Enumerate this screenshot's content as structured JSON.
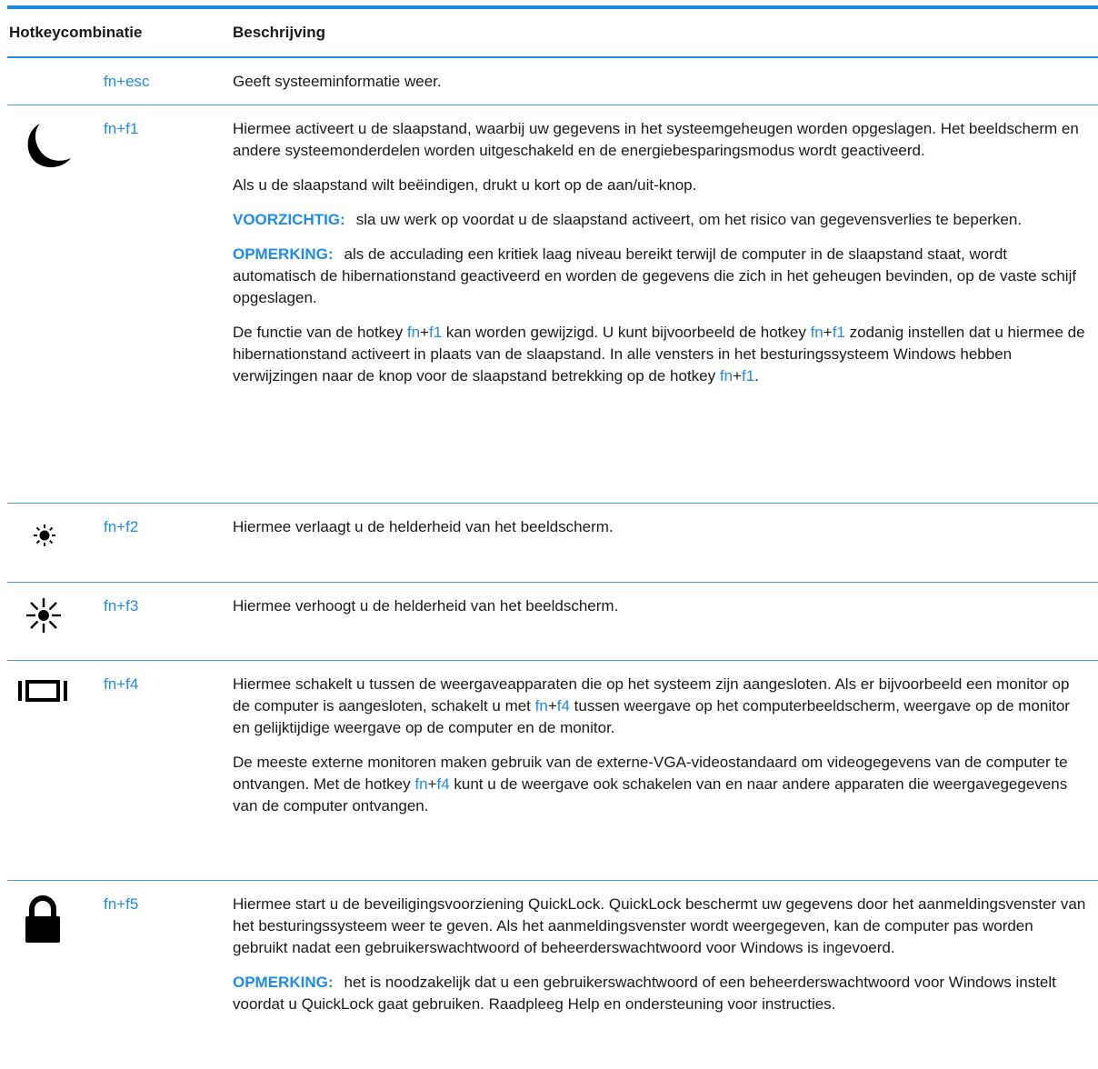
{
  "header": {
    "combo": "Hotkeycombinatie",
    "desc": "Beschrijving"
  },
  "rows": [
    {
      "icon": "none",
      "key": "fn+esc",
      "paragraphs": [
        "Geeft systeeminformatie weer."
      ]
    },
    {
      "icon": "moon-icon",
      "key": "fn+f1",
      "paragraphs": [
        "Hiermee activeert u de slaapstand, waarbij uw gegevens in het systeemgeheugen worden opgeslagen. Het beeldscherm en andere systeemonderdelen worden uitgeschakeld en de energiebesparingsmodus wordt geactiveerd.",
        "Als u de slaapstand wilt beëindigen, drukt u kort op de aan/uit-knop."
      ],
      "caution_label": "VOORZICHTIG:",
      "caution_text": "sla uw werk op voordat u de slaapstand activeert, om het risico van gegevensverlies te beperken.",
      "note_label": "OPMERKING:",
      "note_text": "als de acculading een kritiek laag niveau bereikt terwijl de computer in de slaapstand staat, wordt automatisch de hibernationstand geactiveerd en worden de gegevens die zich in het geheugen bevinden, op de vaste schijf opgeslagen.",
      "last": {
        "t1": "De functie van de hotkey ",
        "fn": "fn",
        "plus": "+",
        "f1": "f1",
        "t2": " kan worden gewijzigd. U kunt bijvoorbeeld de hotkey ",
        "t3": " zodanig instellen dat u hiermee de hibernationstand activeert in plaats van de slaapstand. In alle vensters in het besturingssysteem Windows hebben verwijzingen naar de knop voor de slaapstand betrekking op de hotkey ",
        "t4": "."
      }
    },
    {
      "icon": "brightness-down-icon",
      "key": "fn+f2",
      "paragraphs": [
        "Hiermee verlaagt u de helderheid van het beeldscherm."
      ]
    },
    {
      "icon": "brightness-up-icon",
      "key": "fn+f3",
      "paragraphs": [
        "Hiermee verhoogt u de helderheid van het beeldscherm."
      ]
    },
    {
      "icon": "display-switch-icon",
      "key": "fn+f4",
      "p1": {
        "t1": "Hiermee schakelt u tussen de weergaveapparaten die op het systeem zijn aangesloten. Als er bijvoorbeeld een monitor op de computer is aangesloten, schakelt u met ",
        "fn": "fn",
        "plus": "+",
        "f4": "f4",
        "t2": " tussen weergave op het computerbeeldscherm, weergave op de monitor en gelijktijdige weergave op de computer en de monitor."
      },
      "p2": {
        "t1": "De meeste externe monitoren maken gebruik van de externe-VGA-videostandaard om videogegevens van de computer te ontvangen. Met de hotkey ",
        "t2": " kunt u de weergave ook schakelen van en naar andere apparaten die weergavegegevens van de computer ontvangen."
      }
    },
    {
      "icon": "lock-icon",
      "key": "fn+f5",
      "paragraphs": [
        "Hiermee start u de beveiligingsvoorziening QuickLock. QuickLock beschermt uw gegevens door het aanmeldingsvenster van het besturingssysteem weer te geven. Als het aanmeldingsvenster wordt weergegeven, kan de computer pas worden gebruikt nadat een gebruikerswachtwoord of beheerderswachtwoord voor Windows is ingevoerd."
      ],
      "note_label": "OPMERKING:",
      "note_text": "het is noodzakelijk dat u een gebruikerswachtwoord of een beheerderswachtwoord voor Windows instelt voordat u QuickLock gaat gebruiken. Raadpleeg Help en ondersteuning voor instructies."
    }
  ],
  "colors": {
    "accent": "#1f8ce6",
    "text": "#1a1a1a",
    "icon": "#000000"
  }
}
